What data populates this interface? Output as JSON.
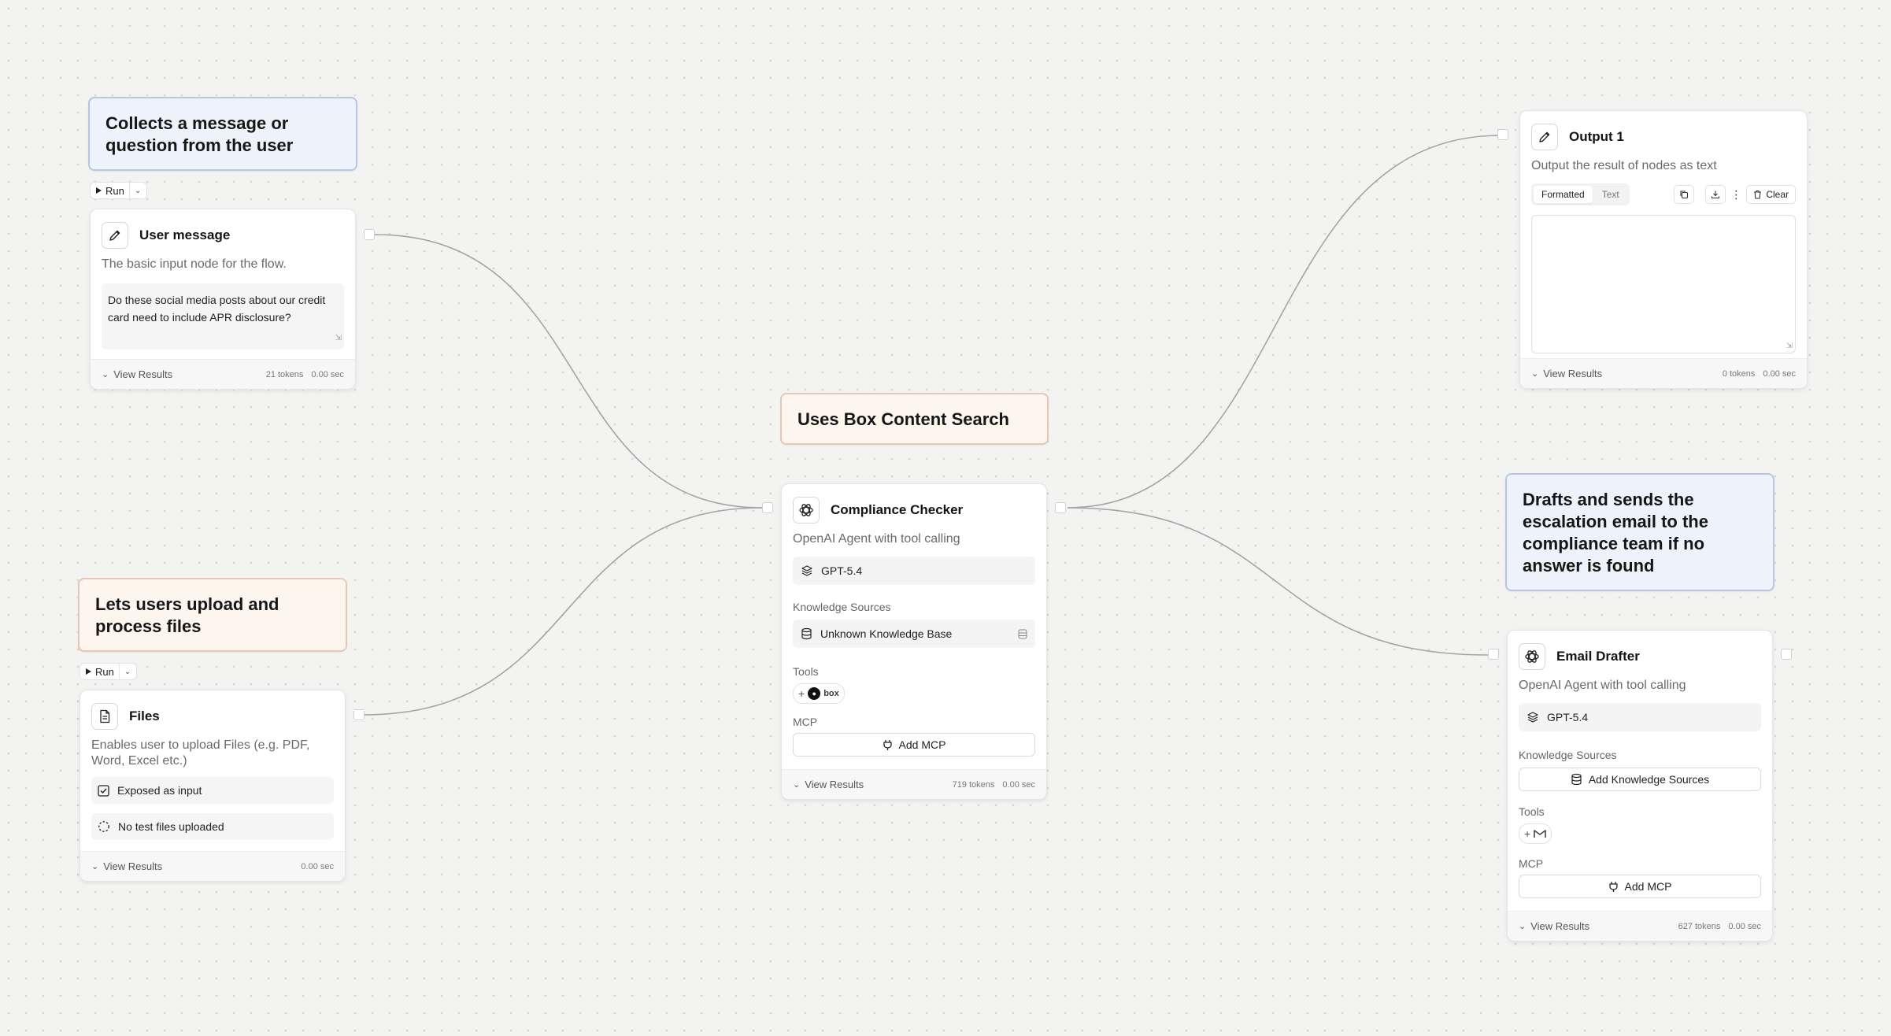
{
  "notes": {
    "user": "Collects a message or question from the user",
    "files": "Lets users upload and process files",
    "box": "Uses Box Content Search",
    "escalation": "Drafts and sends the escalation email to the compliance team if no answer is found"
  },
  "run_label": "Run",
  "user_message": {
    "title": "User message",
    "description": "The basic input node for the flow.",
    "value": "Do these social media posts about our credit card need to include APR disclosure?",
    "view_results": "View Results",
    "tokens": "21 tokens",
    "time": "0.00 sec"
  },
  "files": {
    "title": "Files",
    "description": "Enables user to upload Files (e.g. PDF, Word, Excel etc.)",
    "exposed": "Exposed as input",
    "no_files": "No test files uploaded",
    "view_results": "View Results",
    "time": "0.00 sec"
  },
  "compliance": {
    "title": "Compliance Checker",
    "description": "OpenAI Agent with tool calling",
    "model": "GPT-5.4",
    "ks_label": "Knowledge Sources",
    "ks_value": "Unknown Knowledge Base",
    "tools_label": "Tools",
    "tool_name": "box",
    "mcp_label": "MCP",
    "add_mcp": "Add MCP",
    "view_results": "View Results",
    "tokens": "719 tokens",
    "time": "0.00 sec"
  },
  "output": {
    "title": "Output 1",
    "description": "Output the result of nodes as text",
    "tab_formatted": "Formatted",
    "tab_text": "Text",
    "clear": "Clear",
    "view_results": "View Results",
    "tokens": "0 tokens",
    "time": "0.00 sec"
  },
  "email": {
    "title": "Email Drafter",
    "description": "OpenAI Agent with tool calling",
    "model": "GPT-5.4",
    "ks_label": "Knowledge Sources",
    "add_ks": "Add Knowledge Sources",
    "tools_label": "Tools",
    "mcp_label": "MCP",
    "add_mcp": "Add MCP",
    "view_results": "View Results",
    "tokens": "627 tokens",
    "time": "0.00 sec"
  },
  "colors": {
    "wire": "#a4a4a4",
    "note_blue_bg": "#eef3fb",
    "note_peach_bg": "#fcf6ee"
  }
}
